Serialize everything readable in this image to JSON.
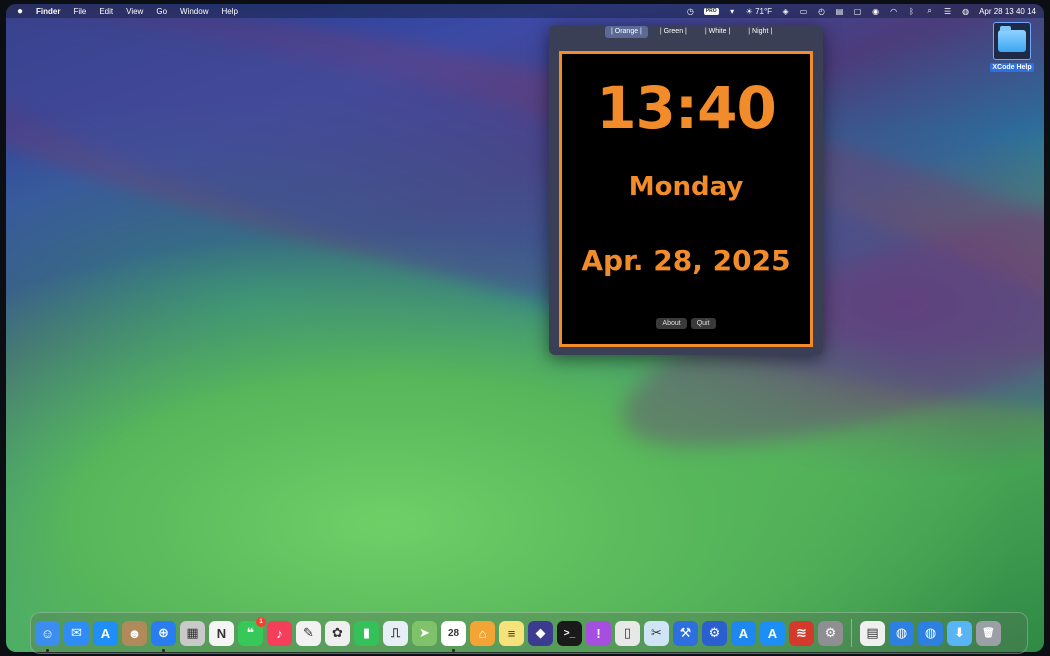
{
  "menubar": {
    "app_name": "Finder",
    "menus": [
      "File",
      "Edit",
      "View",
      "Go",
      "Window",
      "Help"
    ],
    "status": {
      "badge": "PRO",
      "weather": "☀ 71°F",
      "datetime": "Apr 28  13 40 14"
    }
  },
  "clock_window": {
    "tabs": [
      {
        "label": "| Orange |",
        "active": true
      },
      {
        "label": "| Green |",
        "active": false
      },
      {
        "label": "| White |",
        "active": false
      },
      {
        "label": "| Night |",
        "active": false
      }
    ],
    "time": "13:40",
    "day": "Monday",
    "date": "Apr. 28, 2025",
    "buttons": {
      "about": "About",
      "quit": "Quit"
    },
    "accent_color": "#f28c2a"
  },
  "desktop": {
    "folder_label": "XCode Help"
  },
  "dock": {
    "apps": [
      {
        "name": "finder",
        "color": "#3b8ef0",
        "glyph": "☺",
        "running": true
      },
      {
        "name": "mail",
        "color": "#2f8cf5",
        "glyph": "✉"
      },
      {
        "name": "app-store",
        "color": "#1f8ef7",
        "glyph": "A"
      },
      {
        "name": "contacts",
        "color": "#b08a5a",
        "glyph": "☻"
      },
      {
        "name": "safari",
        "color": "#2a7df0",
        "glyph": "⊕",
        "running": true
      },
      {
        "name": "launchpad",
        "color": "#c9c9c9",
        "glyph": "▦"
      },
      {
        "name": "news",
        "color": "#f5f5f5",
        "glyph": "N"
      },
      {
        "name": "messages",
        "color": "#37c85a",
        "glyph": "❝",
        "badge": "1"
      },
      {
        "name": "music",
        "color": "#f53e5a",
        "glyph": "♪"
      },
      {
        "name": "freeform",
        "color": "#f2f2f2",
        "glyph": "✎"
      },
      {
        "name": "photos",
        "color": "#efefef",
        "glyph": "✿"
      },
      {
        "name": "numbers",
        "color": "#35c15a",
        "glyph": "▮"
      },
      {
        "name": "keynote",
        "color": "#e7eef7",
        "glyph": "⎍"
      },
      {
        "name": "maps",
        "color": "#7fc26a",
        "glyph": "➤"
      },
      {
        "name": "calendar",
        "color": "#ffffff",
        "glyph": "28",
        "running": true
      },
      {
        "name": "home",
        "color": "#f3a436",
        "glyph": "⌂"
      },
      {
        "name": "notes",
        "color": "#f5e27a",
        "glyph": "≡"
      },
      {
        "name": "shortcuts",
        "color": "#3b3b8f",
        "glyph": "◆"
      },
      {
        "name": "terminal",
        "color": "#1a1a1a",
        "glyph": ">_"
      },
      {
        "name": "feedback",
        "color": "#a54ee0",
        "glyph": "!"
      },
      {
        "name": "iphone-mirroring",
        "color": "#e8e8e8",
        "glyph": "▯"
      },
      {
        "name": "xcode-preview",
        "color": "#cfe4f5",
        "glyph": "✂"
      },
      {
        "name": "xcode",
        "color": "#2e6fe0",
        "glyph": "⚒"
      },
      {
        "name": "xcode-instruments",
        "color": "#2a5fcf",
        "glyph": "⚙"
      },
      {
        "name": "simulator",
        "color": "#1e88f0",
        "glyph": "A"
      },
      {
        "name": "app-store-2",
        "color": "#1d8ef5",
        "glyph": "A"
      },
      {
        "name": "unknown-red-app",
        "color": "#d33a2c",
        "glyph": "≋"
      },
      {
        "name": "system-settings",
        "color": "#8e8e93",
        "glyph": "⚙"
      }
    ],
    "docs": [
      {
        "name": "document",
        "color": "#f0f0f0",
        "glyph": "▤"
      },
      {
        "name": "globe-1",
        "color": "#2d7fe0",
        "glyph": "◍"
      },
      {
        "name": "globe-2",
        "color": "#2d7fe0",
        "glyph": "◍"
      },
      {
        "name": "downloads-folder",
        "color": "#58b4f5",
        "glyph": "⬇"
      },
      {
        "name": "trash",
        "color": "#9aa0a6",
        "glyph": "🗑"
      }
    ]
  }
}
